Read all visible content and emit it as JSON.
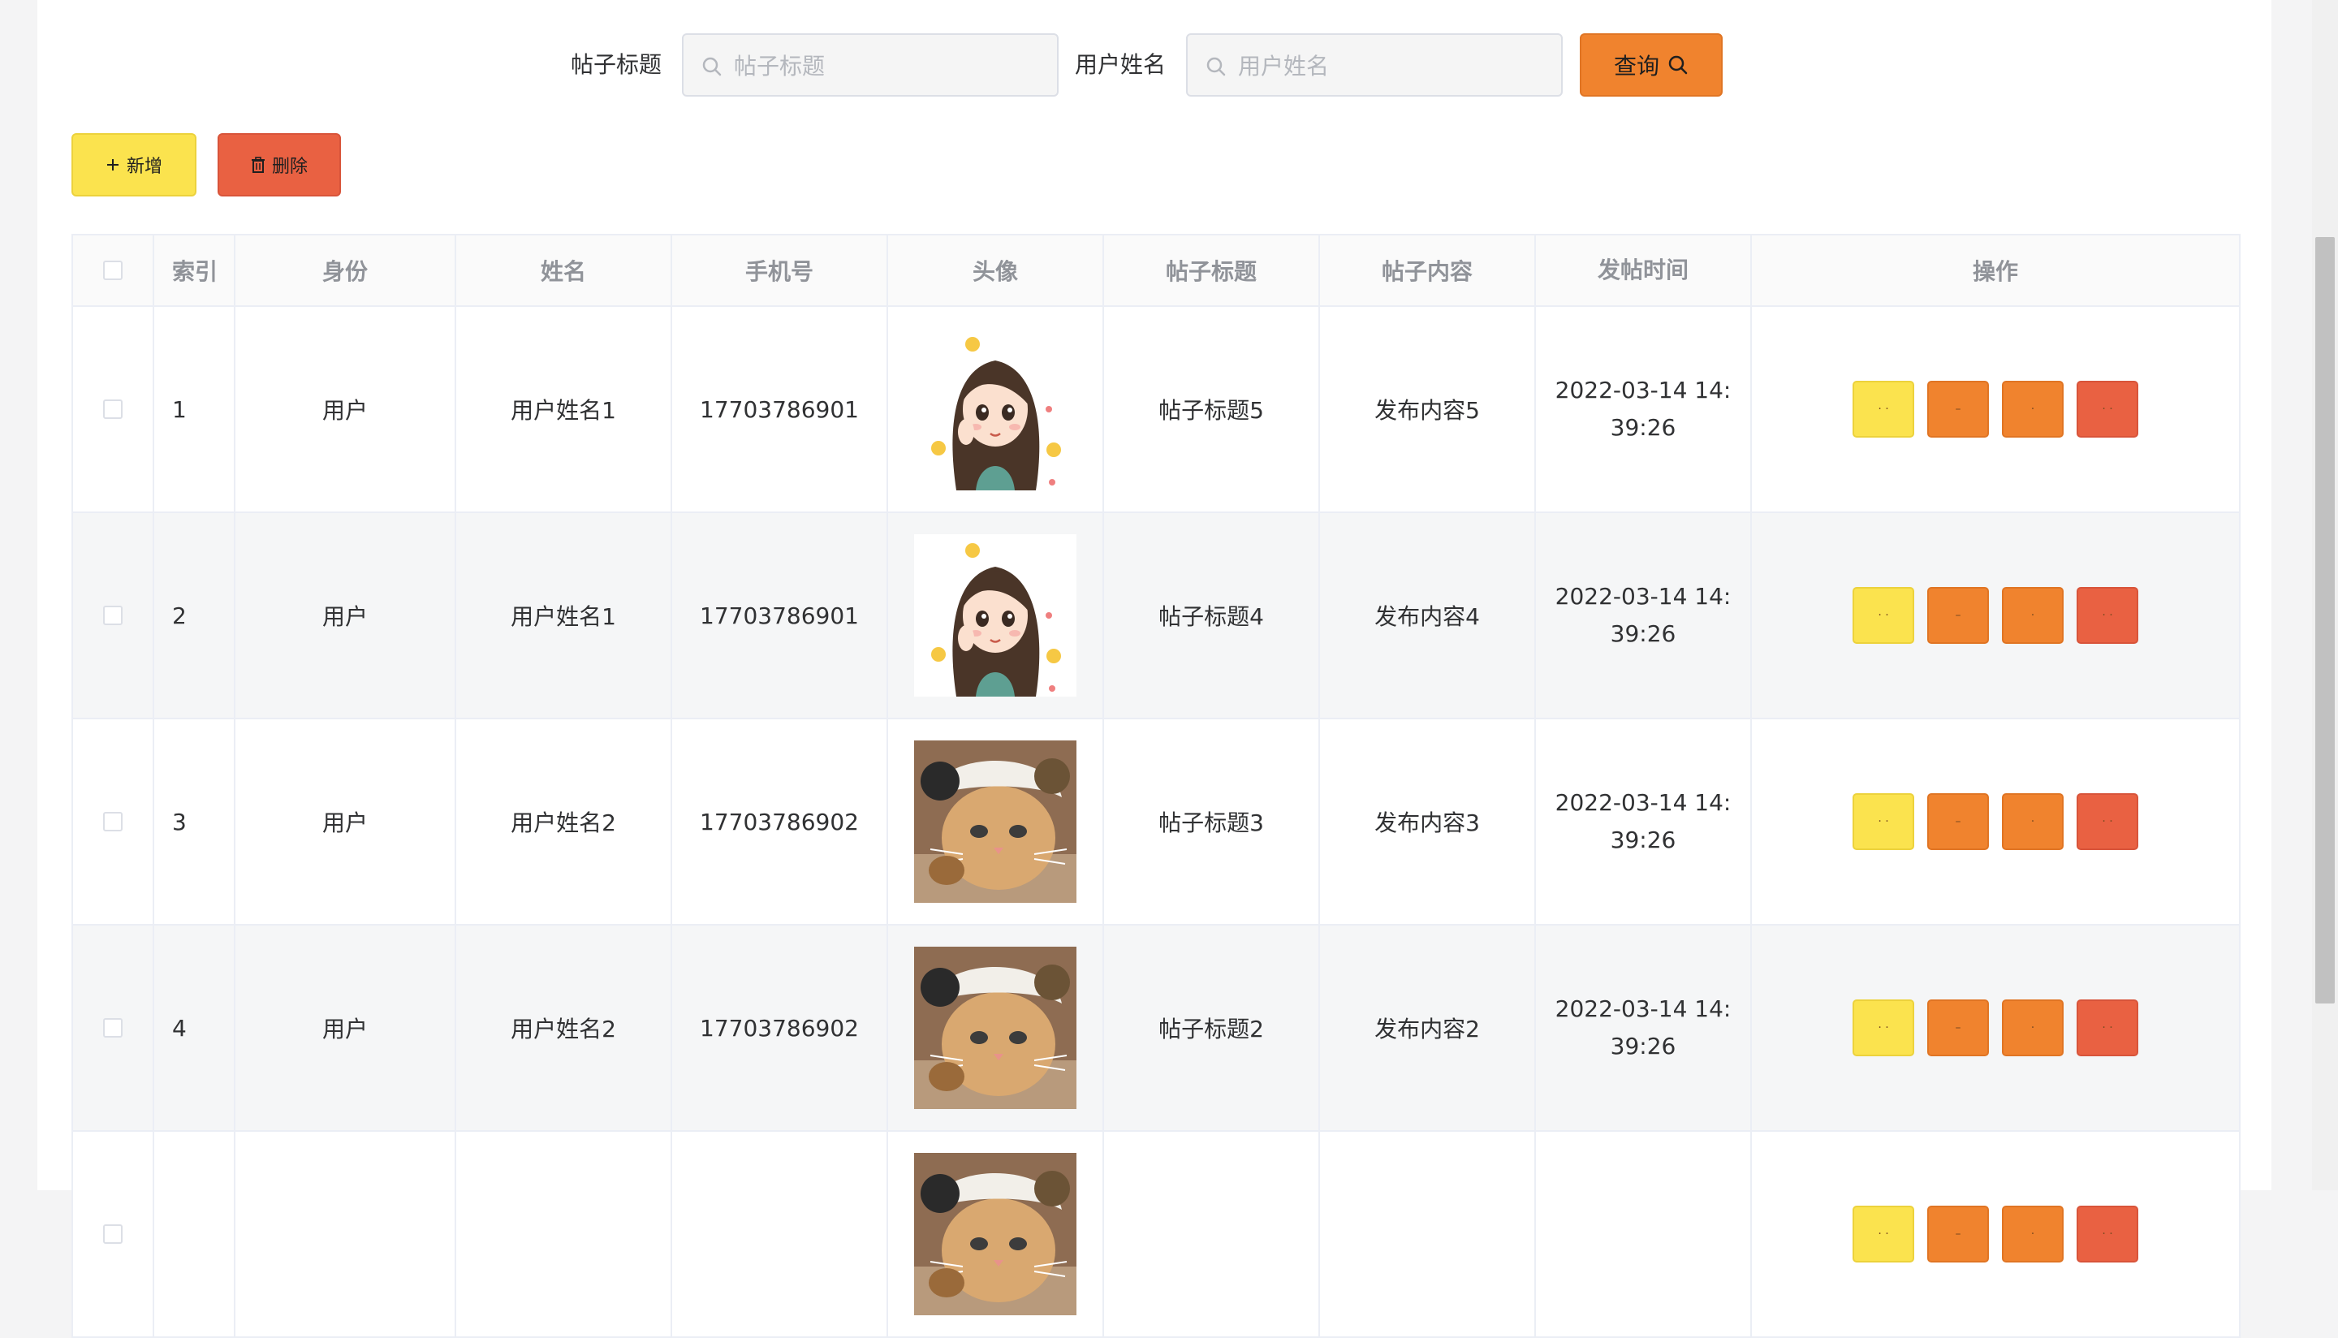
{
  "search": {
    "title_label": "帖子标题",
    "title_placeholder": "帖子标题",
    "name_label": "用户姓名",
    "name_placeholder": "用户姓名",
    "query_label": "查询"
  },
  "toolbar": {
    "add_label": "新增",
    "delete_label": "删除"
  },
  "table": {
    "headers": {
      "index": "索引",
      "role": "身份",
      "name": "姓名",
      "phone": "手机号",
      "avatar": "头像",
      "title": "帖子标题",
      "content": "帖子内容",
      "time": "发帖时间",
      "ops": "操作"
    },
    "rows": [
      {
        "index": "1",
        "role": "用户",
        "name": "用户姓名1",
        "phone": "17703786901",
        "avatar": "cartoon-girl",
        "title": "帖子标题5",
        "content": "发布内容5",
        "time": "2022-03-14 14:39:26"
      },
      {
        "index": "2",
        "role": "用户",
        "name": "用户姓名1",
        "phone": "17703786901",
        "avatar": "cartoon-girl",
        "title": "帖子标题4",
        "content": "发布内容4",
        "time": "2022-03-14 14:39:26"
      },
      {
        "index": "3",
        "role": "用户",
        "name": "用户姓名2",
        "phone": "17703786902",
        "avatar": "cat-with-hat",
        "title": "帖子标题3",
        "content": "发布内容3",
        "time": "2022-03-14 14:39:26"
      },
      {
        "index": "4",
        "role": "用户",
        "name": "用户姓名2",
        "phone": "17703786902",
        "avatar": "cat-with-hat",
        "title": "帖子标题2",
        "content": "发布内容2",
        "time": "2022-03-14 14:39:26"
      },
      {
        "index": "",
        "role": "",
        "name": "",
        "phone": "",
        "avatar": "cat-with-hat",
        "title": "",
        "content": "",
        "time": ""
      }
    ],
    "op_buttons": [
      {
        "label": "· ·",
        "color": "#fbe34e"
      },
      {
        "label": "–",
        "color": "#f0832e"
      },
      {
        "label": "·",
        "color": "#f0832e"
      },
      {
        "label": "· ·",
        "color": "#e96142"
      }
    ]
  }
}
